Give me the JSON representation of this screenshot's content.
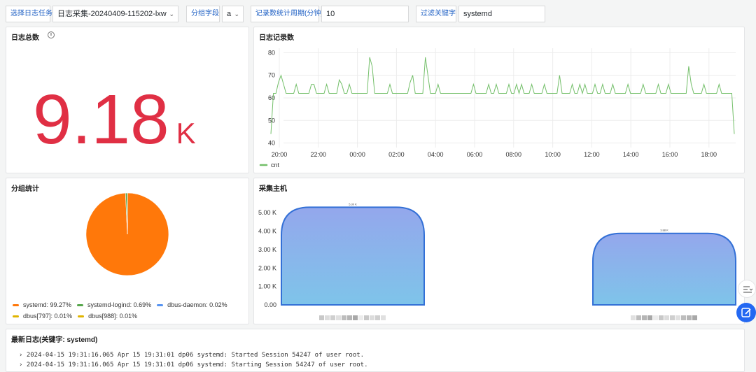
{
  "variables": {
    "task_label": "选择日志任务",
    "task_value": "日志采集-20240409-115202-lxw",
    "group_label": "分组字段",
    "group_value": "a",
    "period_label": "记录数统计周期(分钟)",
    "period_value": "10",
    "keyword_label": "过滤关键字",
    "keyword_value": "systemd"
  },
  "panels": {
    "total": {
      "title": "日志总数",
      "value": "9.18",
      "unit": "K",
      "color": "#e02f44"
    },
    "records": {
      "title": "日志记录数"
    },
    "group_stats": {
      "title": "分组统计"
    },
    "hosts": {
      "title": "采集主机"
    },
    "latest_logs": {
      "title": "最新日志(关键字: systemd)",
      "lines": [
        "2024-04-15 19:31:16.065 Apr 15 19:31:01 dp06 systemd: Started Session 54247 of user root.",
        "2024-04-15 19:31:16.065 Apr 15 19:31:01 dp06 systemd: Starting Session 54247 of user root."
      ]
    }
  },
  "chart_data": [
    {
      "type": "line",
      "title": "日志记录数",
      "x_tick_labels": [
        "20:00",
        "22:00",
        "00:00",
        "02:00",
        "04:00",
        "06:00",
        "08:00",
        "10:00",
        "12:00",
        "14:00",
        "16:00",
        "18:00"
      ],
      "y_tick_labels": [
        "40",
        "50",
        "60",
        "70",
        "80"
      ],
      "ylim": [
        38,
        82
      ],
      "grid": true,
      "legend": "bottom-left",
      "series": [
        {
          "name": "cnt",
          "color": "#73bf69",
          "values": [
            44,
            62,
            62,
            67,
            70,
            66,
            62,
            62,
            62,
            62,
            66,
            62,
            62,
            62,
            62,
            62,
            66,
            66,
            62,
            62,
            62,
            62,
            66,
            62,
            62,
            62,
            62,
            68,
            66,
            62,
            62,
            66,
            62,
            62,
            62,
            62,
            62,
            62,
            62,
            78,
            74,
            62,
            62,
            62,
            62,
            62,
            62,
            66,
            62,
            62,
            62,
            62,
            62,
            62,
            62,
            67,
            70,
            62,
            62,
            62,
            62,
            78,
            70,
            62,
            62,
            62,
            66,
            62,
            62,
            62,
            62,
            62,
            62,
            62,
            62,
            62,
            62,
            62,
            62,
            62,
            66,
            62,
            62,
            62,
            62,
            62,
            66,
            62,
            62,
            66,
            62,
            62,
            62,
            62,
            66,
            62,
            62,
            66,
            62,
            66,
            62,
            62,
            62,
            66,
            62,
            62,
            62,
            62,
            66,
            62,
            62,
            62,
            62,
            62,
            70,
            62,
            62,
            62,
            62,
            66,
            62,
            62,
            66,
            62,
            66,
            62,
            62,
            62,
            66,
            62,
            62,
            66,
            62,
            62,
            62,
            66,
            62,
            62,
            62,
            62,
            62,
            66,
            62,
            62,
            62,
            62,
            62,
            66,
            62,
            62,
            62,
            62,
            62,
            66,
            62,
            62,
            62,
            66,
            62,
            62,
            62,
            62,
            62,
            62,
            62,
            74,
            66,
            62,
            62,
            62,
            62,
            66,
            62,
            62,
            62,
            62,
            62,
            66,
            62,
            62,
            62,
            62,
            62,
            44
          ]
        }
      ]
    },
    {
      "type": "pie",
      "title": "分组统计",
      "legend": "bottom",
      "slices": [
        {
          "name": "systemd",
          "value": 99.27,
          "label": "99.27%",
          "color": "#ff780a"
        },
        {
          "name": "systemd-logind",
          "value": 0.69,
          "label": "0.69%",
          "color": "#56a64b"
        },
        {
          "name": "dbus-daemon",
          "value": 0.02,
          "label": "0.02%",
          "color": "#5794f2"
        },
        {
          "name": "dbus[797]",
          "value": 0.01,
          "label": "0.01%",
          "color": "#e0b400"
        },
        {
          "name": "dbus[988]",
          "value": 0.01,
          "label": "0.01%",
          "color": "#e0b400"
        }
      ]
    },
    {
      "type": "bar",
      "title": "采集主机",
      "categories": [
        "",
        ""
      ],
      "values": [
        5.3,
        3.88
      ],
      "data_labels": [
        "5.30 K",
        "3.88 K"
      ],
      "y_tick_labels": [
        "0.00",
        "1.00 K",
        "2.00 K",
        "3.00 K",
        "4.00 K",
        "5.00 K"
      ],
      "ylim": [
        0,
        5.35
      ],
      "bar_color_top": "#94a7ec",
      "bar_color_bottom": "#7ec4ea",
      "bar_stroke": "#3370d6"
    }
  ]
}
